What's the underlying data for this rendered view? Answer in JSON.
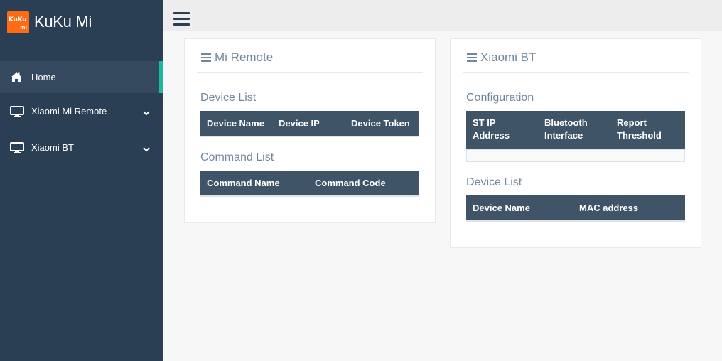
{
  "app": {
    "name": "KuKu Mi",
    "logo_line1": "KuKu",
    "logo_line2": "mi"
  },
  "sidebar": {
    "items": [
      {
        "label": "Home",
        "icon": "home-icon",
        "active": true
      },
      {
        "label": "Xiaomi Mi Remote",
        "icon": "monitor-icon",
        "expandable": true
      },
      {
        "label": "Xiaomi BT",
        "icon": "monitor-icon",
        "expandable": true
      }
    ]
  },
  "panels": {
    "mi_remote": {
      "title": "Mi Remote",
      "device_list_label": "Device List",
      "device_columns": [
        "Device Name",
        "Device IP",
        "Device Token"
      ],
      "command_list_label": "Command List",
      "command_columns": [
        "Command Name",
        "Command Code"
      ]
    },
    "xiaomi_bt": {
      "title": "Xiaomi BT",
      "configuration_label": "Configuration",
      "config_columns": [
        "ST IP Address",
        "Bluetooth Interface",
        "Report Threshold"
      ],
      "device_list_label": "Device List",
      "device_columns": [
        "Device Name",
        "MAC address"
      ]
    }
  },
  "colors": {
    "sidebar_bg": "#2a3f54",
    "active_item_bg": "#34495e",
    "accent": "#1abb9c",
    "table_header_bg": "#405467",
    "logo_bg": "#ff6a13"
  }
}
